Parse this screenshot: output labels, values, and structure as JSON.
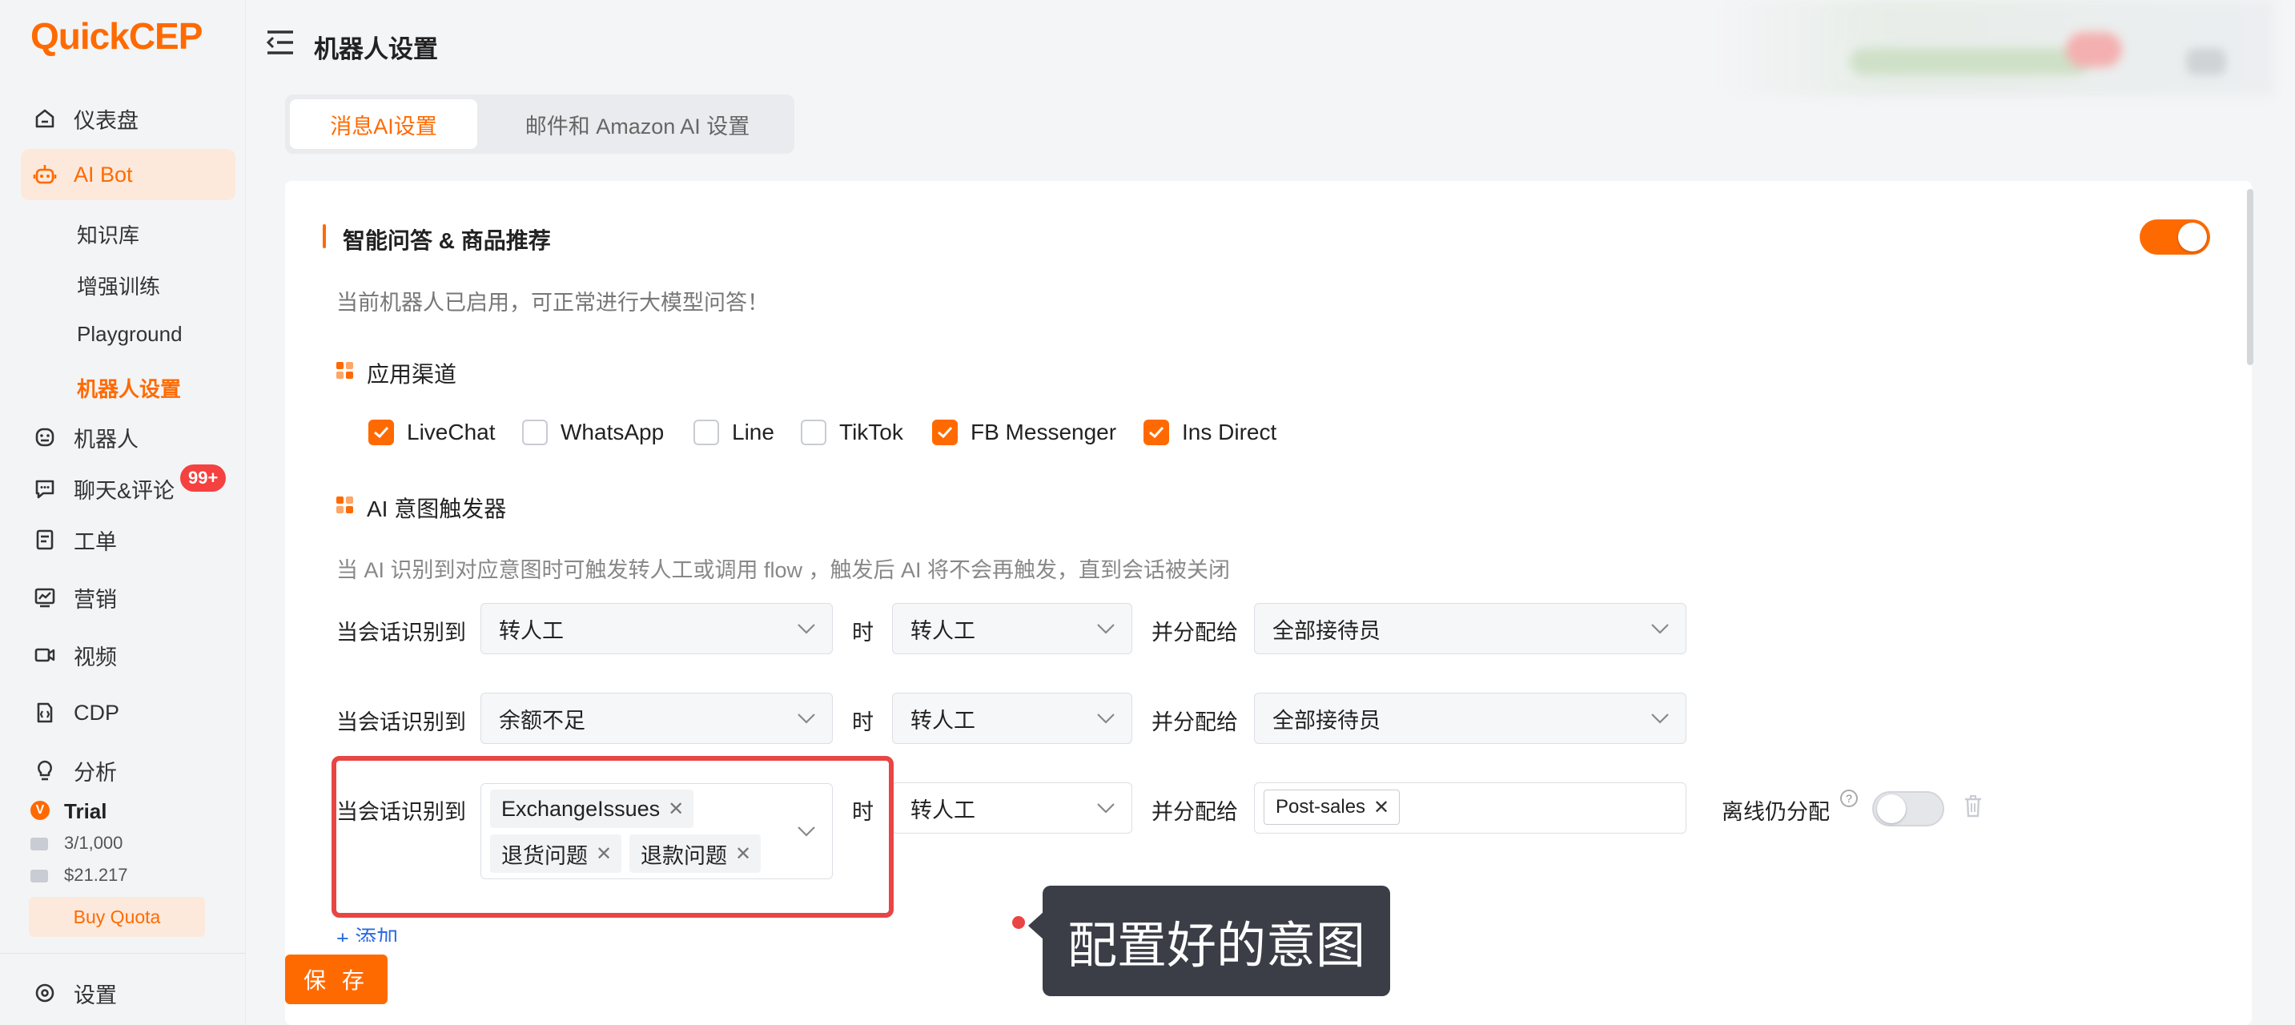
{
  "brand": {
    "logo_text": "QuickCEP",
    "accent": "#ff6a00"
  },
  "sidebar": {
    "items": [
      {
        "label": "仪表盘",
        "icon": "home-icon"
      },
      {
        "label": "AI Bot",
        "icon": "robot-icon",
        "active": true
      },
      {
        "label": "机器人",
        "icon": "bot-face-icon"
      },
      {
        "label": "聊天&评论",
        "icon": "chat-icon"
      },
      {
        "label": "工单",
        "icon": "ticket-icon"
      },
      {
        "label": "营销",
        "icon": "chart-icon"
      },
      {
        "label": "视频",
        "icon": "video-icon"
      },
      {
        "label": "CDP",
        "icon": "cdp-icon"
      },
      {
        "label": "分析",
        "icon": "bulb-icon"
      },
      {
        "label": "设置",
        "icon": "settings-icon"
      }
    ],
    "sub_items": [
      {
        "label": "知识库"
      },
      {
        "label": "增强训练"
      },
      {
        "label": "Playground"
      },
      {
        "label": "机器人设置",
        "active": true
      }
    ],
    "chat_badge": "99+",
    "trial": {
      "label": "Trial",
      "messages": "3/1,000",
      "balance": "$21.217",
      "buy_label": "Buy Quota"
    }
  },
  "header": {
    "title": "机器人设置"
  },
  "tabs": [
    {
      "label": "消息AI设置",
      "active": true
    },
    {
      "label": "邮件和 Amazon AI 设置",
      "active": false
    }
  ],
  "section": {
    "title": "智能问答 & 商品推荐",
    "enabled": true,
    "status_text": "当前机器人已启用，可正常进行大模型问答！"
  },
  "channels": {
    "title": "应用渠道",
    "items": [
      {
        "label": "LiveChat",
        "checked": true
      },
      {
        "label": "WhatsApp",
        "checked": false
      },
      {
        "label": "Line",
        "checked": false
      },
      {
        "label": "TikTok",
        "checked": false
      },
      {
        "label": "FB Messenger",
        "checked": true
      },
      {
        "label": "Ins Direct",
        "checked": true
      }
    ]
  },
  "triggers": {
    "title": "AI 意图触发器",
    "description": "当 AI 识别到对应意图时可触发转人工或调用 flow ，触发后 AI 将不会再触发，直到会话被关闭",
    "when_label": "当会话识别到",
    "then_label": "时",
    "assign_label": "并分配给",
    "rows": [
      {
        "intent": "转人工",
        "action": "转人工",
        "assignee": "全部接待员"
      },
      {
        "intent": "余额不足",
        "action": "转人工",
        "assignee": "全部接待员"
      },
      {
        "intent_tags": [
          "ExchangeIssues",
          "退货问题",
          "退款问题"
        ],
        "action": "转人工",
        "assignee_tags": [
          "Post-sales"
        ],
        "offline_label": "离线仍分配",
        "offline_enabled": false
      }
    ],
    "add_label": "+ 添加"
  },
  "save_label": "保 存",
  "tooltip": {
    "text": "配置好的意图"
  }
}
